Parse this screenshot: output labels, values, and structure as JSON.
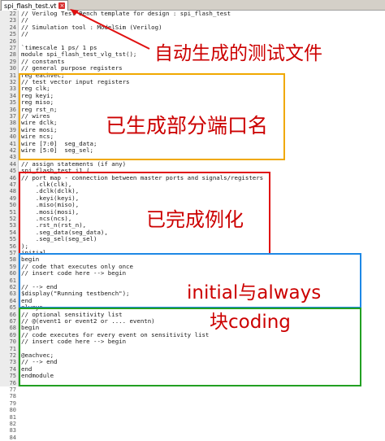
{
  "tab": {
    "filename": "spi_flash_test.vt",
    "close_glyph": "×"
  },
  "gutter": {
    "line_numbers": [
      22,
      23,
      24,
      25,
      26,
      27,
      28,
      29,
      30,
      31,
      32,
      33,
      34,
      35,
      36,
      37,
      38,
      39,
      40,
      41,
      42,
      43,
      44,
      45,
      46,
      47,
      48,
      49,
      50,
      51,
      52,
      53,
      54,
      55,
      56,
      57,
      58,
      59,
      60,
      61,
      62,
      63,
      64,
      65,
      66,
      67,
      68,
      69,
      70,
      71,
      72,
      73,
      74,
      75,
      76,
      77,
      78,
      79,
      80,
      81,
      82,
      83,
      84
    ]
  },
  "code_lines": [
    "// Verilog Test Bench template for design : spi_flash_test",
    "//",
    "// Simulation tool : ModelSim (Verilog)",
    "//",
    "",
    "`timescale 1 ps/ 1 ps",
    "module spi_flash_test_vlg_tst();",
    "// constants",
    "// general purpose registers",
    "reg eachvec;",
    "// test vector input registers",
    "reg clk;",
    "reg keyi;",
    "reg miso;",
    "reg rst_n;",
    "// wires",
    "wire dclk;",
    "wire mosi;",
    "wire ncs;",
    "wire [7:0]  seg_data;",
    "wire [5:0]  seg_sel;",
    "",
    "// assign statements (if any)",
    "spi_flash_test i1 (",
    "// port map - connection between master ports and signals/registers",
    "    .clk(clk),",
    "    .dclk(dclk),",
    "    .keyi(keyi),",
    "    .miso(miso),",
    "    .mosi(mosi),",
    "    .ncs(ncs),",
    "    .rst_n(rst_n),",
    "    .seg_data(seg_data),",
    "    .seg_sel(seg_sel)",
    ");",
    "initial",
    "begin",
    "// code that executes only once",
    "// insert code here --> begin",
    "",
    "// --> end",
    "$display(\"Running testbench\");",
    "end",
    "always",
    "// optional sensitivity list",
    "// @(event1 or event2 or .... eventn)",
    "begin",
    "// code executes for every event on sensitivity list",
    "// insert code here --> begin",
    "",
    "@eachvec;",
    "// --> end",
    "end",
    "endmodule"
  ],
  "annotations": {
    "auto_generated": "自动生成的测试文件",
    "ports_generated": "已生成部分端口名",
    "instantiated": "已完成例化",
    "initial_always_line1": "initial与always",
    "initial_always_line2": "块coding"
  },
  "colors": {
    "red": "#e01010",
    "orange": "#f0a800",
    "blue": "#1e88e5",
    "green": "#22a022"
  }
}
